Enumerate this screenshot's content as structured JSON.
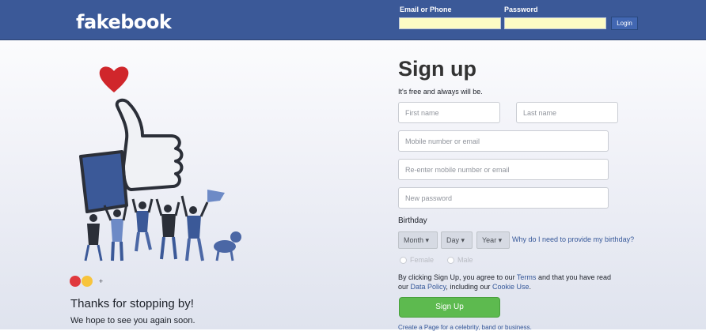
{
  "header": {
    "logo": "fakebook",
    "email_label": "Email or Phone",
    "password_label": "Password",
    "email_value": "",
    "password_value": "",
    "login_label": "Login"
  },
  "left": {
    "thanks": "Thanks for stopping by!",
    "hope": "We hope to see you again soon."
  },
  "signup": {
    "title": "Sign up",
    "subtitle": "It's free and always will be.",
    "first_name_placeholder": "First name",
    "last_name_placeholder": "Last name",
    "mobile_placeholder": "Mobile number or email",
    "reenter_placeholder": "Re-enter mobile number or email",
    "password_placeholder": "New password",
    "birthday_label": "Birthday",
    "month_label": "Month ▾",
    "day_label": "Day ▾",
    "year_label": "Year ▾",
    "why_link": "Why do I need to provide my birthday?",
    "female_label": "Female",
    "male_label": "Male",
    "terms_prefix": "By clicking Sign Up, you agree to our",
    "terms_link": "Terms",
    "terms_mid": "and that you have read our",
    "data_policy_link": "Data Policy",
    "terms_mid2": ", including our",
    "cookie_link": "Cookie Use",
    "terms_end": ".",
    "signup_label": "Sign Up",
    "page_link": "Create a Page for a celebrity, band or business."
  },
  "colors": {
    "brand": "#3b5998",
    "input_yellow": "#fdfcc4",
    "signup_green": "#5dba4f",
    "link": "#365899"
  }
}
